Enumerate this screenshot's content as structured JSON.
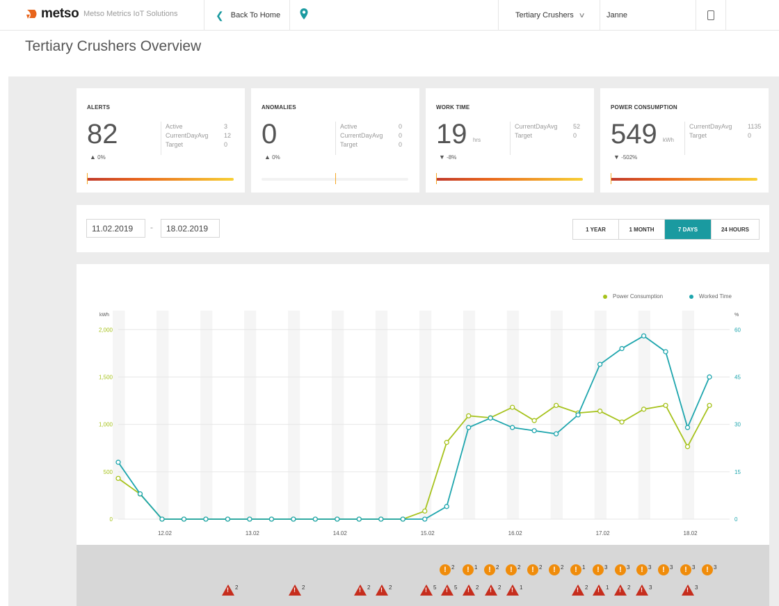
{
  "header": {
    "logo_text": "metso",
    "app_name": "Metso Metrics IoT Solutions",
    "back_label": "Back To Home",
    "site_selected": "Tertiary Crushers",
    "user_name": "Janne",
    "icons": [
      "location-pin-icon",
      "chevron-left-icon",
      "chevron-down-icon",
      "device-icon"
    ]
  },
  "page_title": "Tertiary Crushers Overview",
  "kpis": [
    {
      "title": "ALERTS",
      "value": "82",
      "unit": "",
      "delta": "0%",
      "delta_dir": "up",
      "stats": [
        {
          "label": "Active",
          "value": "3"
        },
        {
          "label": "CurrentDayAvg",
          "value": "12"
        },
        {
          "label": "Target",
          "value": "0"
        }
      ],
      "bar": "gradient",
      "marker": 0.0
    },
    {
      "title": "ANOMALIES",
      "value": "0",
      "unit": "",
      "delta": "0%",
      "delta_dir": "up",
      "stats": [
        {
          "label": "Active",
          "value": "0"
        },
        {
          "label": "CurrentDayAvg",
          "value": "0"
        },
        {
          "label": "Target",
          "value": "0"
        }
      ],
      "bar": "empty",
      "marker": 0.5
    },
    {
      "title": "WORK TIME",
      "value": "19",
      "unit": "hrs",
      "delta": "-8%",
      "delta_dir": "down",
      "stats": [
        {
          "label": "CurrentDayAvg",
          "value": "52"
        },
        {
          "label": "Target",
          "value": "0"
        }
      ],
      "bar": "gradient",
      "marker": 0.0
    },
    {
      "title": "POWER CONSUMPTION",
      "value": "549",
      "unit": "kWh",
      "delta": "-502%",
      "delta_dir": "down",
      "stats": [
        {
          "label": "CurrentDayAvg",
          "value": "1135"
        },
        {
          "label": "Target",
          "value": "0"
        }
      ],
      "bar": "gradient",
      "marker": 0.0
    }
  ],
  "filter": {
    "date_from": "11.02.2019",
    "separator": "-",
    "date_to": "18.02.2019",
    "ranges": [
      "1 YEAR",
      "1 MONTH",
      "7 DAYS",
      "24 HOURS"
    ],
    "active_range": "7 DAYS"
  },
  "colors": {
    "accent": "#1a9aa0",
    "power": "#a6c21b",
    "worked": "#1da5ad",
    "bar_start": "#c0392b",
    "bar_end": "#f8d034",
    "alert_circle": "#f08c0a",
    "alert_triangle": "#c62d1d"
  },
  "chart_data": {
    "type": "line",
    "legend_position": "top-right",
    "grid": true,
    "y_left": {
      "label": "kWh",
      "ticks": [
        "0",
        "500",
        "1,000",
        "1,500",
        "2,000"
      ],
      "range": [
        0,
        2200
      ]
    },
    "y_right": {
      "label": "%",
      "ticks": [
        "0",
        "15",
        "30",
        "45",
        "60"
      ],
      "range": [
        0,
        66
      ]
    },
    "x_ticks": [
      "12.02",
      "13.02",
      "14.02",
      "15.02",
      "16.02",
      "17.02",
      "18.02"
    ],
    "x": [
      "11.02 06:00",
      "11.02 18:00",
      "12.02 06:00",
      "12.02 18:00",
      "13.02 06:00",
      "13.02 18:00",
      "14.02 06:00",
      "14.02 18:00",
      "15.02 06:00",
      "15.02 18:00",
      "16.02 06:00",
      "16.02 18:00",
      "17.02 06:00",
      "17.02 18:00",
      "18.02 06:00",
      "18.02 18:00",
      "19.02 06:00",
      "19.02 18:00",
      "20.02 06:00",
      "20.02 18:00",
      "21.02 06:00",
      "21.02 18:00",
      "22.02 06:00",
      "22.02 18:00",
      "23.02 06:00",
      "23.02 18:00",
      "24.02 06:00",
      "24.02 18:00"
    ],
    "series": [
      {
        "name": "Power Consumption",
        "axis": "left",
        "values": [
          430,
          265,
          0,
          0,
          0,
          0,
          0,
          0,
          0,
          0,
          0,
          0,
          0,
          0,
          85,
          810,
          1090,
          1070,
          1180,
          1040,
          1200,
          1120,
          1140,
          1025,
          1160,
          1200,
          765,
          1200
        ]
      },
      {
        "name": "Worked Time",
        "axis": "right",
        "values": [
          18,
          8,
          0,
          0,
          0,
          0,
          0,
          0,
          0,
          0,
          0,
          0,
          0,
          0,
          0,
          4,
          29,
          32,
          29,
          28,
          27,
          33,
          49,
          54,
          58,
          53,
          29,
          45
        ]
      }
    ]
  },
  "events": {
    "orange": [
      {
        "count": "2"
      },
      {
        "count": "1"
      },
      {
        "count": "2"
      },
      {
        "count": "2"
      },
      {
        "count": "2"
      },
      {
        "count": "2"
      },
      {
        "count": "1"
      },
      {
        "count": "3"
      },
      {
        "count": "3"
      },
      {
        "count": "3"
      },
      {
        "count": "3"
      },
      {
        "count": "3"
      },
      {
        "count": "3"
      }
    ],
    "red": [
      {
        "count": "2"
      },
      {
        "count": "2"
      },
      {
        "count": "2"
      },
      {
        "count": "2"
      },
      {
        "count": "5"
      },
      {
        "count": "5"
      },
      {
        "count": "2"
      },
      {
        "count": "2"
      },
      {
        "count": "1"
      },
      {
        "count": "2"
      },
      {
        "count": "1"
      },
      {
        "count": "2"
      },
      {
        "count": "3"
      },
      {
        "count": "3"
      }
    ]
  }
}
